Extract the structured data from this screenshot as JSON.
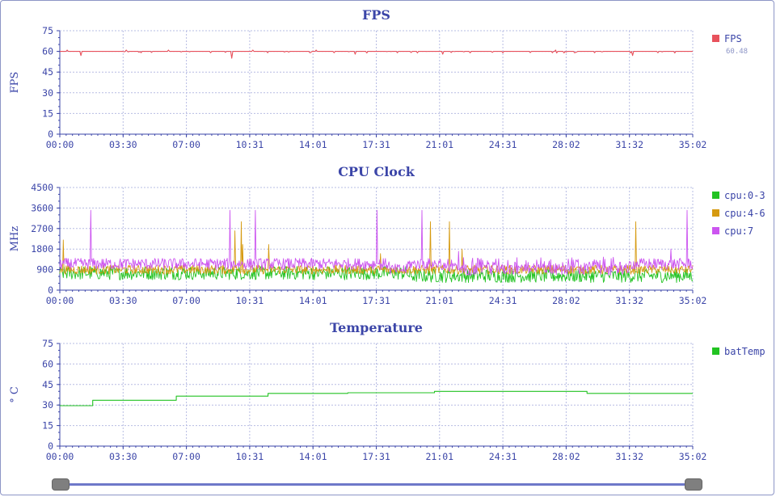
{
  "chart_data": [
    {
      "type": "line",
      "title": "FPS",
      "ylabel": "FPS",
      "xlabel": "",
      "ylim": [
        0,
        75
      ],
      "yticks": [
        "0",
        "15",
        "30",
        "45",
        "60",
        "75"
      ],
      "xticks": [
        "00:00",
        "03:30",
        "07:00",
        "10:31",
        "14:01",
        "17:31",
        "21:01",
        "24:31",
        "28:02",
        "31:32",
        "35:02"
      ],
      "x_range_seconds": [
        0,
        2102
      ],
      "grid": true,
      "legend_position": "right",
      "series": [
        {
          "name": "FPS",
          "color": "#e8525c",
          "summary": "60.48",
          "baseline": 60,
          "dips": [
            [
              30,
              57
            ],
            [
              115,
              59
            ],
            [
              215,
              59
            ],
            [
              245,
              55
            ],
            [
              295,
              59
            ],
            [
              355,
              59
            ],
            [
              390,
              59
            ],
            [
              420,
              58
            ],
            [
              480,
              59
            ],
            [
              545,
              58
            ],
            [
              630,
              59
            ],
            [
              700,
              59
            ],
            [
              760,
              59
            ],
            [
              815,
              57
            ],
            [
              850,
              59
            ]
          ],
          "spikes": [
            [
              10,
              61
            ],
            [
              95,
              61
            ],
            [
              155,
              61
            ],
            [
              275,
              61
            ],
            [
              365,
              61
            ],
            [
              705,
              61
            ]
          ]
        }
      ]
    },
    {
      "type": "line",
      "title": "CPU Clock",
      "ylabel": "MHz",
      "xlabel": "",
      "ylim": [
        0,
        4500
      ],
      "yticks": [
        "0",
        "900",
        "1800",
        "2700",
        "3600",
        "4500"
      ],
      "xticks": [
        "00:00",
        "03:30",
        "07:00",
        "10:31",
        "14:01",
        "17:31",
        "21:01",
        "24:31",
        "28:02",
        "31:32",
        "35:02"
      ],
      "x_range_seconds": [
        0,
        2102
      ],
      "grid": true,
      "legend_position": "right",
      "series": [
        {
          "name": "cpu:0-3",
          "color": "#22c322",
          "base": 750,
          "amp": 300
        },
        {
          "name": "cpu:4-6",
          "color": "#d69a10",
          "base": 900,
          "amp": 200,
          "spikes_pct": [
            [
              0.5,
              2200
            ],
            [
              27.7,
              2600
            ],
            [
              28.7,
              3000
            ],
            [
              28.9,
              2000
            ],
            [
              33.0,
              2000
            ],
            [
              50.7,
              1600
            ],
            [
              58.5,
              3000
            ],
            [
              61.5,
              3000
            ],
            [
              63.5,
              1800
            ],
            [
              91.0,
              3000
            ]
          ]
        },
        {
          "name": "cpu:7",
          "color": "#cc55f0",
          "base": 1150,
          "amp": 250,
          "spikes_pct": [
            [
              4.9,
              3500
            ],
            [
              26.9,
              3500
            ],
            [
              30.9,
              3500
            ],
            [
              50.1,
              3500
            ],
            [
              57.2,
              3500
            ],
            [
              99.1,
              3500
            ],
            [
              63.0,
              1700
            ],
            [
              96.5,
              1800
            ]
          ]
        }
      ]
    },
    {
      "type": "line",
      "title": "Temperature",
      "ylabel": "° C",
      "xlabel": "",
      "ylim": [
        0,
        75
      ],
      "yticks": [
        "0",
        "15",
        "30",
        "45",
        "60",
        "75"
      ],
      "xticks": [
        "00:00",
        "03:30",
        "07:00",
        "10:31",
        "14:01",
        "17:31",
        "21:01",
        "24:31",
        "28:02",
        "31:32",
        "35:02"
      ],
      "x_range_seconds": [
        0,
        2102
      ],
      "grid": true,
      "legend_position": "right",
      "series": [
        {
          "name": "batTemp",
          "color": "#22c322",
          "steps_pct": [
            [
              0,
              29.5
            ],
            [
              5.2,
              33.5
            ],
            [
              18.4,
              36.5
            ],
            [
              32.9,
              38.5
            ],
            [
              45.5,
              39
            ],
            [
              59.2,
              40
            ],
            [
              83.3,
              38.5
            ],
            [
              100,
              38.5
            ]
          ]
        }
      ]
    }
  ],
  "slider": {
    "start_fraction": 0,
    "end_fraction": 1
  }
}
